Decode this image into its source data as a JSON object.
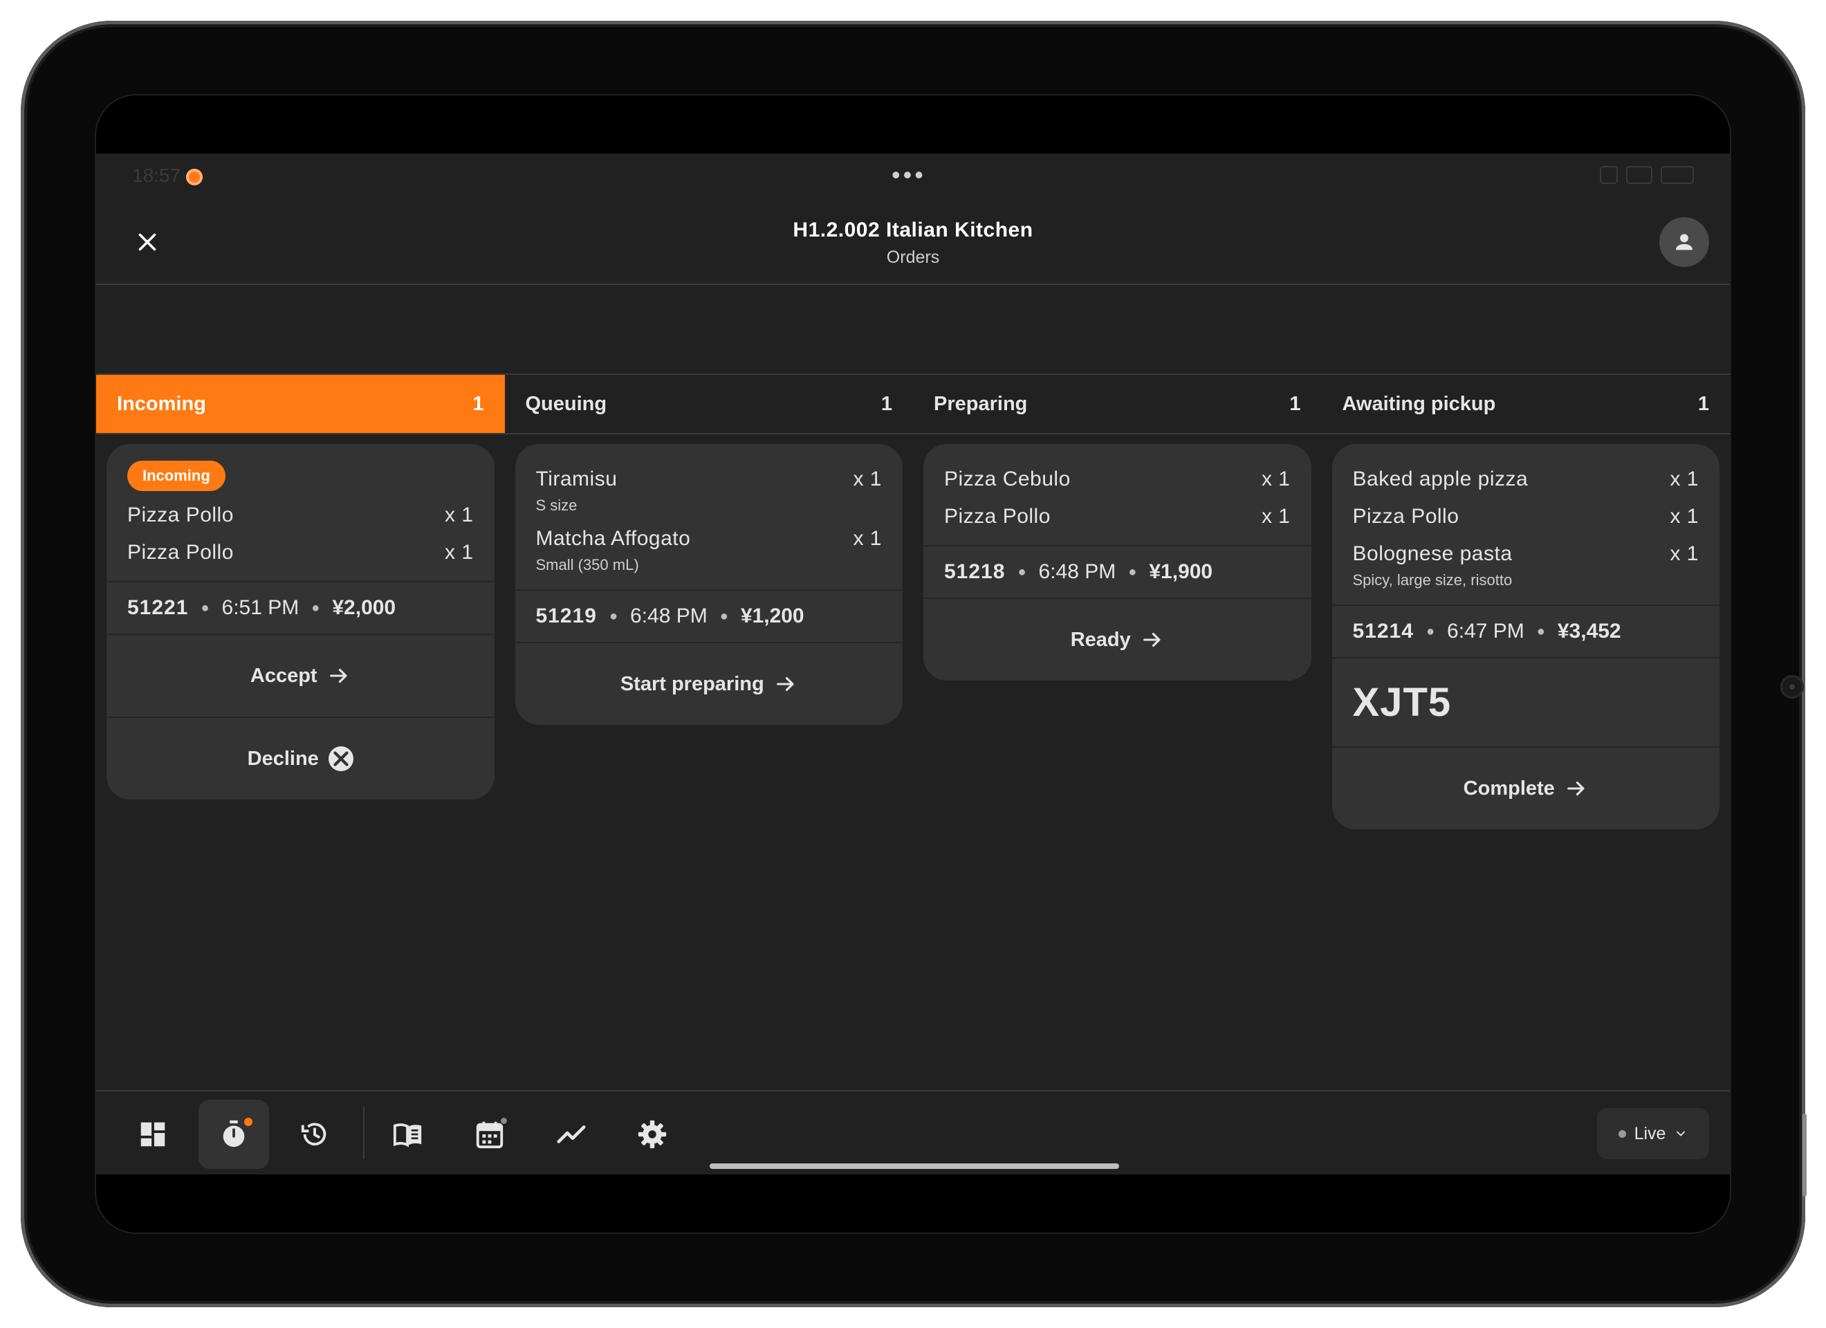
{
  "status_bar": {
    "time": "18:57"
  },
  "header": {
    "title": "H1.2.002 Italian Kitchen",
    "subtitle": "Orders"
  },
  "columns": [
    {
      "label": "Incoming",
      "count": "1",
      "active": true
    },
    {
      "label": "Queuing",
      "count": "1"
    },
    {
      "label": "Preparing",
      "count": "1"
    },
    {
      "label": "Awaiting pickup",
      "count": "1"
    }
  ],
  "cards": {
    "incoming": {
      "badge": "Incoming",
      "items": [
        {
          "name": "Pizza Pollo",
          "qty": "x 1"
        },
        {
          "name": "Pizza Pollo",
          "qty": "x 1"
        }
      ],
      "order_no": "51221",
      "time": "6:51 PM",
      "price": "¥2,000",
      "accept_label": "Accept",
      "decline_label": "Decline"
    },
    "queuing": {
      "items": [
        {
          "name": "Tiramisu",
          "qty": "x 1",
          "note": "S size"
        },
        {
          "name": "Matcha Affogato",
          "qty": "x 1",
          "note": "Small (350 mL)"
        }
      ],
      "order_no": "51219",
      "time": "6:48 PM",
      "price": "¥1,200",
      "action_label": "Start preparing"
    },
    "preparing": {
      "items": [
        {
          "name": "Pizza Cebulo",
          "qty": "x 1"
        },
        {
          "name": "Pizza Pollo",
          "qty": "x 1"
        }
      ],
      "order_no": "51218",
      "time": "6:48 PM",
      "price": "¥1,900",
      "action_label": "Ready"
    },
    "awaiting": {
      "items": [
        {
          "name": "Baked apple pizza",
          "qty": "x 1"
        },
        {
          "name": "Pizza Pollo",
          "qty": "x 1"
        },
        {
          "name": "Bolognese pasta",
          "qty": "x 1",
          "note": "Spicy, large size, risotto"
        }
      ],
      "order_no": "51214",
      "time": "6:47 PM",
      "price": "¥3,452",
      "pickup_code": "XJT5",
      "action_label": "Complete"
    }
  },
  "bottom_nav": {
    "items": [
      "dashboard-icon",
      "timer-icon",
      "history-icon",
      "menu-book-icon",
      "calendar-icon",
      "analytics-icon",
      "settings-icon"
    ],
    "mode_label": "Live"
  },
  "colors": {
    "accent": "#ff7a12",
    "background": "#212121",
    "card": "#333333"
  }
}
